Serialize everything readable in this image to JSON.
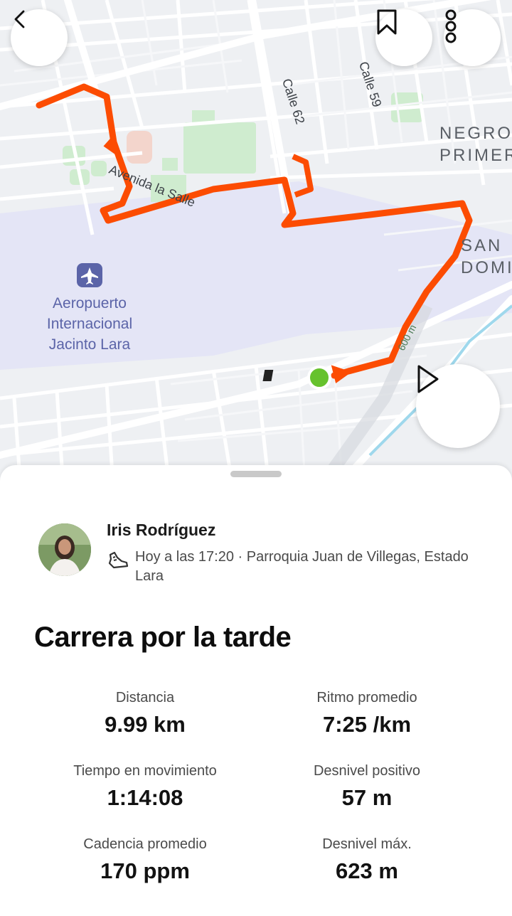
{
  "map": {
    "streets": [
      "Calle 62",
      "Calle 59",
      "Avenida la Salle"
    ],
    "airport_name": "Aeropuerto Internacional Jacinto Lara",
    "neighborhoods": [
      "NEGRO PRIMERO",
      "SAN DOMINGO"
    ],
    "distance_marker": "600 m",
    "route_color": "#fc4c02",
    "start_color": "#66c22d"
  },
  "controls": {
    "back_icon": "chevron-left-icon",
    "bookmark_icon": "bookmark-icon",
    "more_icon": "more-vertical-icon",
    "play_icon": "play-icon"
  },
  "activity": {
    "athlete_name": "Iris Rodríguez",
    "sport_icon": "running-shoe-icon",
    "meta": "Hoy a las 17:20 · Parroquia Juan de Villegas, Estado Lara",
    "title": "Carrera por la tarde"
  },
  "stats": [
    {
      "label": "Distancia",
      "value": "9.99 km"
    },
    {
      "label": "Ritmo promedio",
      "value": "7:25 /km"
    },
    {
      "label": "Tiempo en movimiento",
      "value": "1:14:08"
    },
    {
      "label": "Desnivel positivo",
      "value": "57 m"
    },
    {
      "label": "Cadencia promedio",
      "value": "170 ppm"
    },
    {
      "label": "Desnivel máx.",
      "value": "623 m"
    }
  ]
}
